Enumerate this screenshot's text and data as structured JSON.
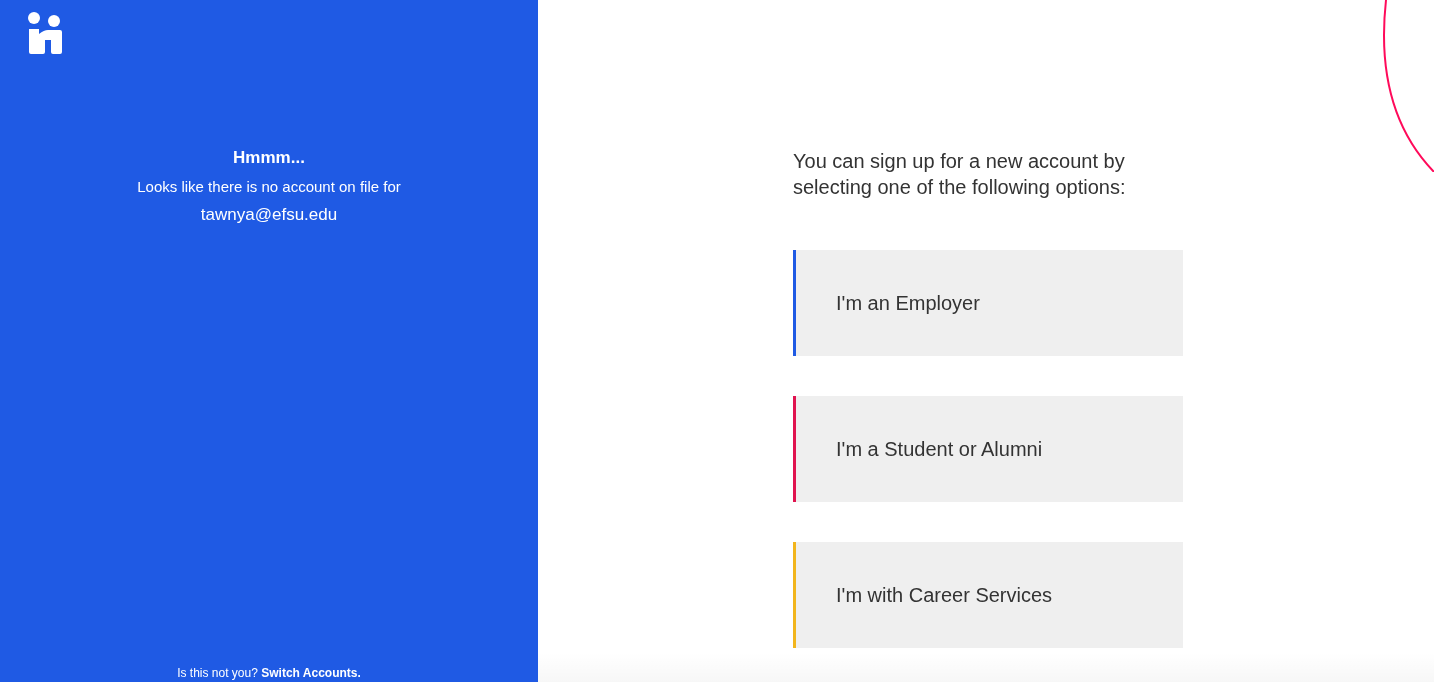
{
  "left_panel": {
    "heading": "Hmmm...",
    "message": "Looks like there is no account on file for",
    "email": "tawnya@efsu.edu",
    "footer": {
      "question": "Is this not you?",
      "link": "Switch Accounts."
    }
  },
  "prompt": "You can sign up for a new account by selecting one of the following options:",
  "options": [
    {
      "label": "I'm an Employer",
      "color": "#1f5ae4"
    },
    {
      "label": "I'm a Student or Alumni",
      "color": "#e0134f"
    },
    {
      "label": "I'm with Career Services",
      "color": "#f2b51c"
    }
  ]
}
